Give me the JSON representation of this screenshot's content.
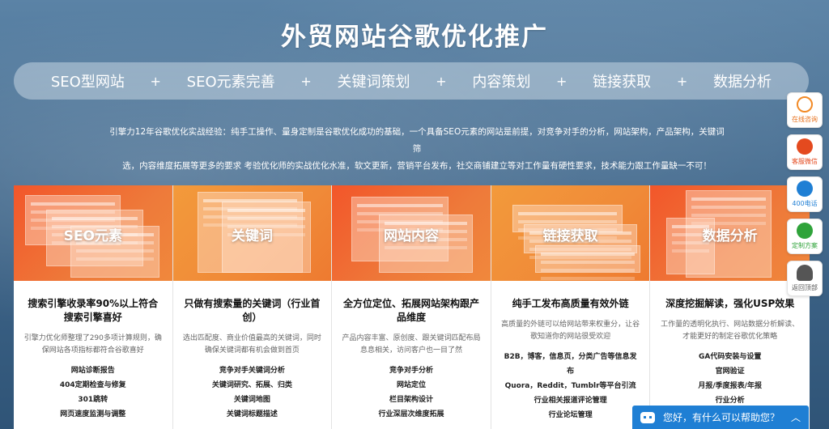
{
  "page": {
    "title": "外贸网站谷歌优化推广"
  },
  "nav": {
    "items": [
      "SEO型网站",
      "SEO元素完善",
      "关键词策划",
      "内容策划",
      "链接获取",
      "数据分析"
    ],
    "separator": "+"
  },
  "intro": {
    "line1": "引擎力12年谷歌优化实战经验：纯手工操作、量身定制是谷歌优化成功的基础，一个具备SEO元素的网站是前提，对竞争对手的分析，网站架构，产品架构，关键词筛",
    "line2": "选，内容维度拓展等更多的要求 考验优化师的实战优化水准，软文更新，营销平台发布，社交商铺建立等对工作量有硬性要求，技术能力跟工作量缺一不可！"
  },
  "cards": [
    {
      "image_label": "SEO元素",
      "headline": "搜索引擎收录率90%以上符合搜索引擎喜好",
      "desc": "引擎力优化师整理了290多项计算规则，确保网站各项指标都符合谷歌喜好",
      "items": [
        "网站诊断报告",
        "404定期检查与修复",
        "301跳转",
        "网页速度监测与调整"
      ]
    },
    {
      "image_label": "关键词",
      "headline": "只做有搜索量的关键词（行业首创）",
      "desc": "选出匹配度、商业价值最高的关键词，同时确保关键词都有机会做到首页",
      "items": [
        "竞争对手关键词分析",
        "关键词研究、拓展、归类",
        "关键词地图",
        "关键词标题描述"
      ]
    },
    {
      "image_label": "网站内容",
      "headline": "全方位定位、拓展网站架构跟产品维度",
      "desc": "产品内容丰富、原创度、跟关键词匹配布局息息相关，访问客户也一目了然",
      "items": [
        "竞争对手分析",
        "网站定位",
        "栏目架构设计",
        "行业深层次维度拓展"
      ]
    },
    {
      "image_label": "链接获取",
      "headline": "纯手工发布高质量有效外链",
      "desc": "高质量的外链可以给网站带来权重分，让谷歌知道你的网站很受欢迎",
      "items": [
        "B2B，博客，信息页，分类广告等信息发布",
        "Quora，Reddit，Tumblr等平台引流",
        "行业相关报道评论管理",
        "行业论坛管理"
      ]
    },
    {
      "image_label": "数据分析",
      "headline": "深度挖掘解读，强化USP效果",
      "desc": "工作量的透明化执行、网站数据分析解读、才能更好的制定谷歌优化策略",
      "items": [
        "GA代码安装与设置",
        "官网验证",
        "月报/季度报表/年报",
        "行业分析"
      ]
    }
  ],
  "sidebar": {
    "consult": "在线咨询",
    "wechat": "客服微信",
    "phone": "400电话",
    "plan": "定制方案",
    "top": "返回顶部"
  },
  "chat": {
    "text": "您好，有什么可以帮助您？",
    "caret": "︿"
  },
  "colors": {
    "accent_orange": "#f2562a",
    "chat_blue": "#1f7fd4"
  }
}
